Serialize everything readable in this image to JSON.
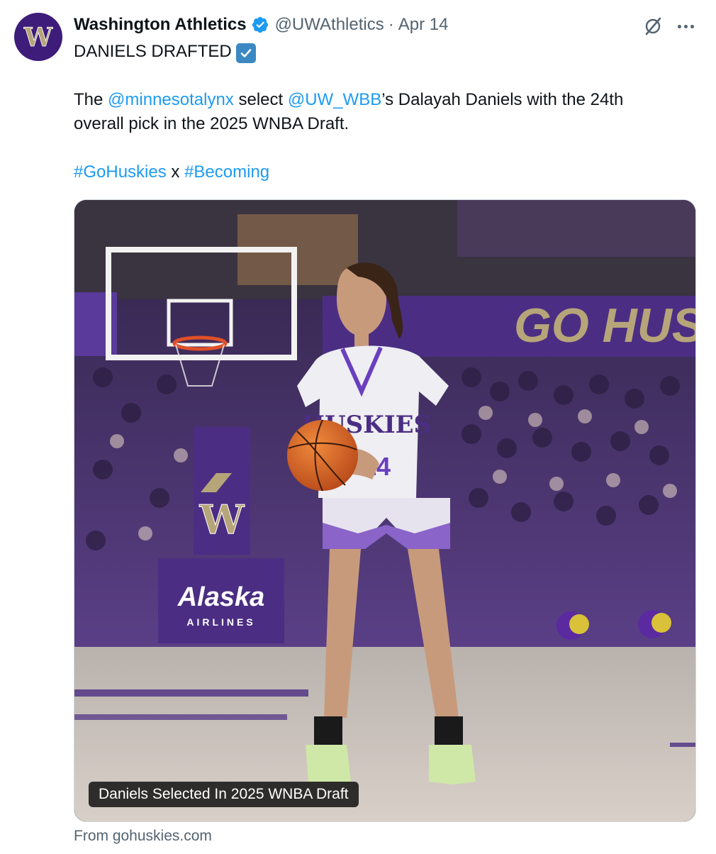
{
  "author": {
    "display_name": "Washington Athletics",
    "handle": "@UWAthletics",
    "separator": "·",
    "date": "Apr 14",
    "avatar_letter": "W",
    "avatar_color": "#3d1c7a",
    "verified_icon": "verified-badge-icon"
  },
  "actions": {
    "grok_icon": "grok-icon",
    "more_icon": "more-options-icon"
  },
  "tweet": {
    "headline": "DANIELS DRAFTED",
    "headline_emoji": "check-mark-button-emoji",
    "body_prefix": "The ",
    "mention_1": "@minnesotalynx",
    "body_middle": " select ",
    "mention_2": "@UW_WBB",
    "body_suffix": "’s Dalayah Daniels with the 24th",
    "body_line2": "overall pick in the 2025 WNBA Draft.",
    "hashtag_1": "#GoHuskies",
    "hashtag_joiner": " x ",
    "hashtag_2": "#Becoming"
  },
  "media": {
    "caption": "Daniels Selected In 2025 WNBA Draft",
    "banner_text": "GO HUS",
    "jersey_text": "HUSKIES",
    "jersey_number": "14",
    "stanchion_letter": "W",
    "sponsor_name": "Alaska",
    "sponsor_sub": "AIRLINES"
  },
  "link_card": {
    "source": "From gohuskies.com"
  },
  "colors": {
    "link": "#1d9bf0",
    "muted": "#536471",
    "uw_purple": "#4b2e83",
    "uw_gold": "#b7a57a"
  }
}
